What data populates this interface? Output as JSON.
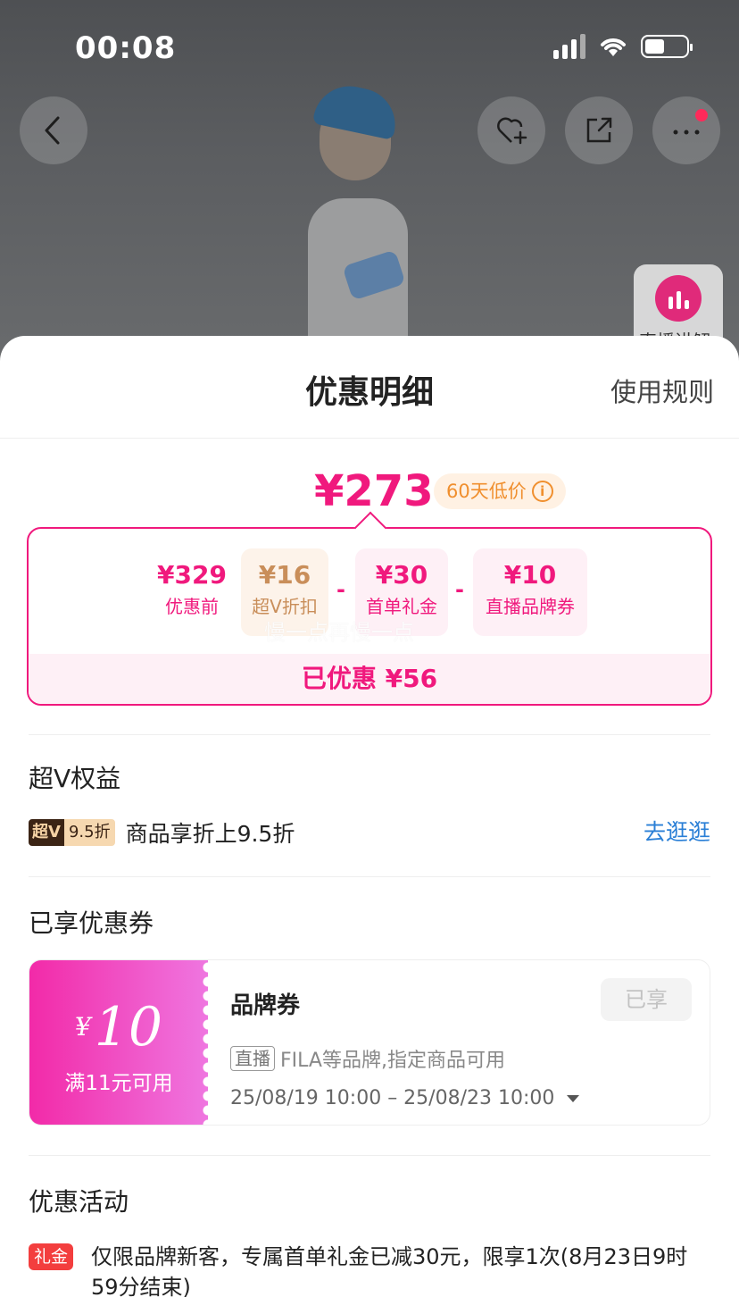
{
  "status_bar": {
    "time": "00:08"
  },
  "top_actions": {
    "live_label": "直播讲解"
  },
  "sheet": {
    "title": "优惠明细",
    "rules_label": "使用规则"
  },
  "price": {
    "final": "¥273",
    "low_badge": "60天低价",
    "info_glyph": "i"
  },
  "breakdown": {
    "items": [
      {
        "amount": "¥329",
        "label": "优惠前"
      },
      {
        "amount": "¥16",
        "label": "超V折扣"
      },
      {
        "amount": "¥30",
        "label": "首单礼金"
      },
      {
        "amount": "¥10",
        "label": "直播品牌券"
      }
    ],
    "operator": "-",
    "watermark": "慢一点再慢一点",
    "saved": "已优惠 ¥56"
  },
  "vip": {
    "section_title": "超V权益",
    "tag_a": "超V",
    "tag_b": "9.5折",
    "text": "商品享折上9.5折",
    "link": "去逛逛"
  },
  "coupons": {
    "section_title": "已享优惠券",
    "item": {
      "currency": "¥",
      "value": "10",
      "condition": "满11元可用",
      "name": "品牌券",
      "status": "已享",
      "tag": "直播",
      "desc": "FILA等品牌,指定商品可用",
      "dates": "25/08/19 10:00 – 25/08/23 10:00"
    }
  },
  "activities": {
    "section_title": "优惠活动",
    "tag": "礼金",
    "text": "仅限品牌新客，专属首单礼金已减30元，限享1次(8月23日9时59分结束)"
  },
  "colors": {
    "accent": "#f0197d",
    "link": "#2a7fd6",
    "vip_gold": "#c98e5a"
  }
}
